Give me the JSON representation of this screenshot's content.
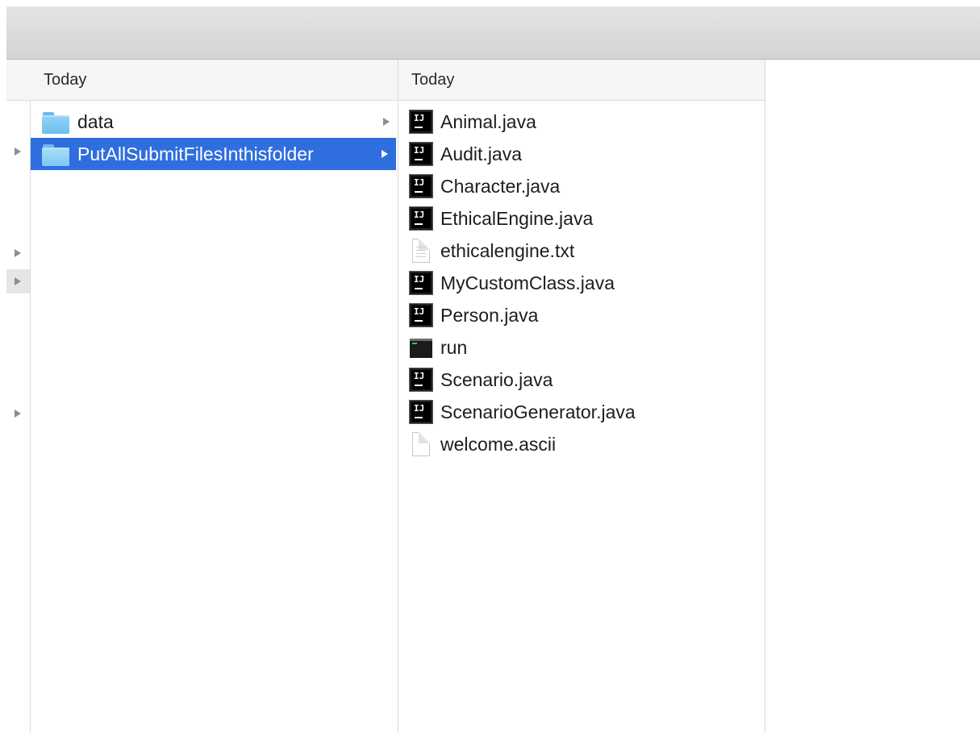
{
  "finder": {
    "column1": {
      "header": "Today",
      "items": [
        {
          "label": "data",
          "icon": "folder-icon",
          "has_children": true,
          "selected": false
        },
        {
          "label": "PutAllSubmitFilesInthisfolder",
          "icon": "folder-icon",
          "has_children": true,
          "selected": true
        }
      ]
    },
    "column2": {
      "header": "Today",
      "items": [
        {
          "label": "Animal.java",
          "icon": "intellij-java-icon"
        },
        {
          "label": "Audit.java",
          "icon": "intellij-java-icon"
        },
        {
          "label": "Character.java",
          "icon": "intellij-java-icon"
        },
        {
          "label": "EthicalEngine.java",
          "icon": "intellij-java-icon"
        },
        {
          "label": "ethicalengine.txt",
          "icon": "text-file-icon"
        },
        {
          "label": "MyCustomClass.java",
          "icon": "intellij-java-icon"
        },
        {
          "label": "Person.java",
          "icon": "intellij-java-icon"
        },
        {
          "label": "run",
          "icon": "terminal-exec-icon"
        },
        {
          "label": "Scenario.java",
          "icon": "intellij-java-icon"
        },
        {
          "label": "ScenarioGenerator.java",
          "icon": "intellij-java-icon"
        },
        {
          "label": "welcome.ascii",
          "icon": "blank-file-icon"
        }
      ]
    }
  },
  "colors": {
    "selection": "#2f6ede",
    "folder": "#6dbfee",
    "header_bg": "#f5f5f5"
  }
}
